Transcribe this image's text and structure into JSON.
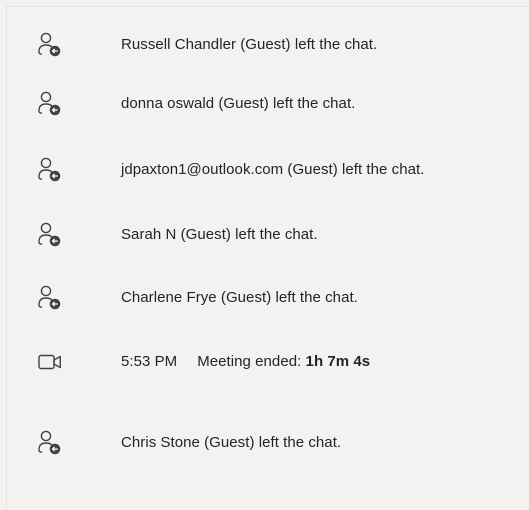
{
  "events": [
    {
      "icon": "person-left-icon",
      "text": "Russell Chandler (Guest) left the chat."
    },
    {
      "icon": "person-left-icon",
      "text": "donna oswald (Guest) left the chat."
    },
    {
      "icon": "person-left-icon",
      "text": "jdpaxton1@outlook.com (Guest) left the chat."
    },
    {
      "icon": "person-left-icon",
      "text": "Sarah N (Guest) left the chat."
    },
    {
      "icon": "person-left-icon",
      "text": "Charlene Frye (Guest) left the chat."
    }
  ],
  "meeting": {
    "icon": "video-camera-icon",
    "time": "5:53 PM",
    "label": "Meeting ended: ",
    "duration": "1h 7m 4s"
  },
  "last_event": {
    "icon": "person-left-icon",
    "text": "Chris Stone (Guest) left the chat."
  },
  "colors": {
    "background": "#f3f2f1",
    "text": "#252423",
    "icon": "#424242"
  }
}
